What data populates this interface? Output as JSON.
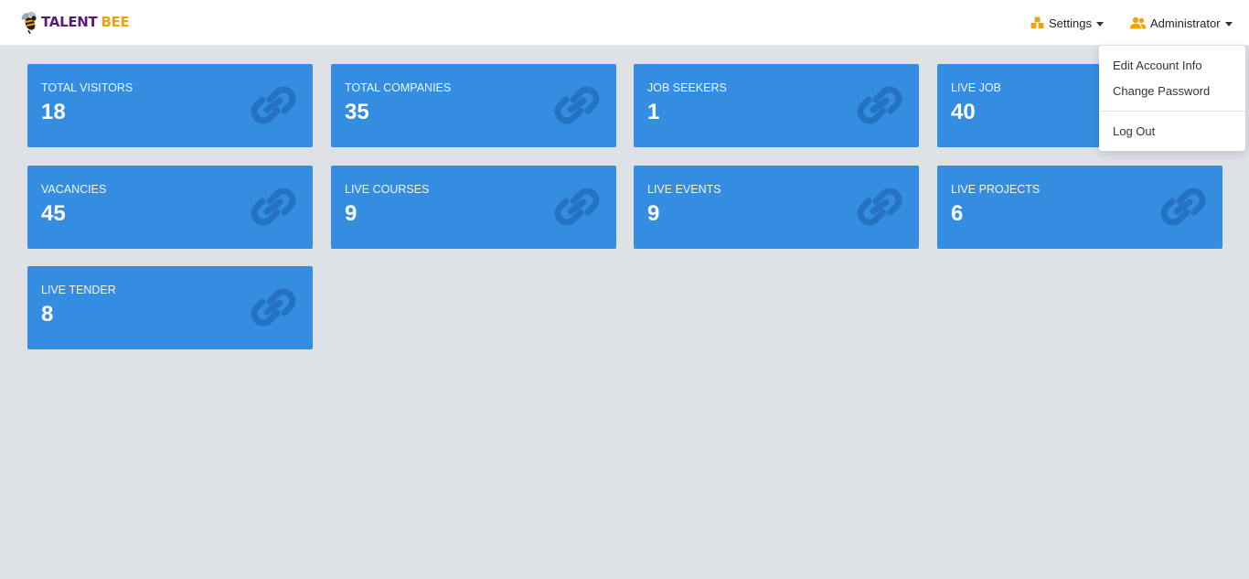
{
  "brand": {
    "logo_part1": "TALENT",
    "logo_part2": "BEE",
    "colors": {
      "talent": "#5b1a73",
      "bee": "#f0a20c"
    }
  },
  "header": {
    "settings_label": "Settings",
    "settings_icon": "cubes-icon",
    "admin_label": "Administrator",
    "admin_icon": "users-icon",
    "icon_color": "#f0a20c"
  },
  "user_menu": {
    "items": [
      {
        "label": "Edit Account Info"
      },
      {
        "label": "Change Password"
      },
      {
        "label": "Log Out"
      }
    ]
  },
  "cards": [
    {
      "label": "TOTAL VISITORS",
      "value": "18",
      "icon": "link-icon"
    },
    {
      "label": "TOTAL COMPANIES",
      "value": "35",
      "icon": "link-icon"
    },
    {
      "label": "JOB SEEKERS",
      "value": "1",
      "icon": "link-icon"
    },
    {
      "label": "LIVE JOB",
      "value": "40",
      "icon": "link-icon"
    },
    {
      "label": "VACANCIES",
      "value": "45",
      "icon": "link-icon"
    },
    {
      "label": "LIVE COURSES",
      "value": "9",
      "icon": "link-icon"
    },
    {
      "label": "LIVE EVENTS",
      "value": "9",
      "icon": "link-icon"
    },
    {
      "label": "LIVE PROJECTS",
      "value": "6",
      "icon": "link-icon"
    },
    {
      "label": "LIVE TENDER",
      "value": "8",
      "icon": "link-icon"
    }
  ],
  "theme": {
    "card_color": "#358de2",
    "card_icon_color": "#2473c2",
    "background": "#dee1e6"
  }
}
